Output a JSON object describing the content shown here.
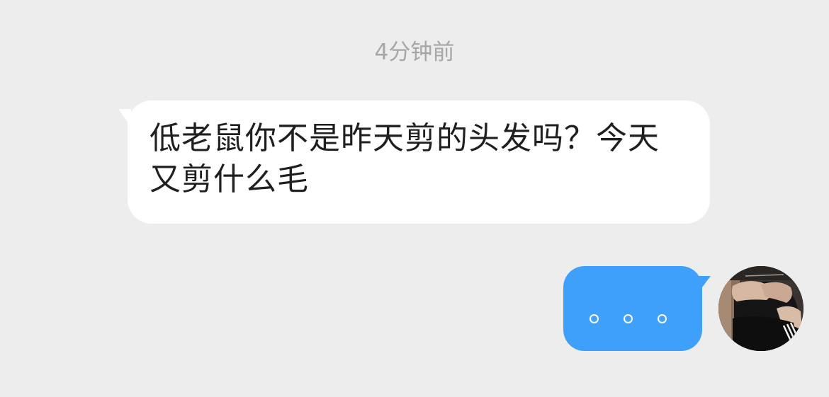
{
  "chat": {
    "timestamp": "4分钟前",
    "messages": [
      {
        "sender": "other",
        "text": "低老鼠你不是昨天剪的头发吗？今天又剪什么毛"
      },
      {
        "sender": "self",
        "typing_indicator": "。。。"
      }
    ]
  },
  "colors": {
    "background": "#ededed",
    "incoming_bubble": "#ffffff",
    "outgoing_bubble": "#3fa0fc",
    "timestamp_text": "#a6a6a6",
    "message_text": "#1f1f1f"
  },
  "icons": {
    "self_avatar": "user-avatar-photo"
  }
}
